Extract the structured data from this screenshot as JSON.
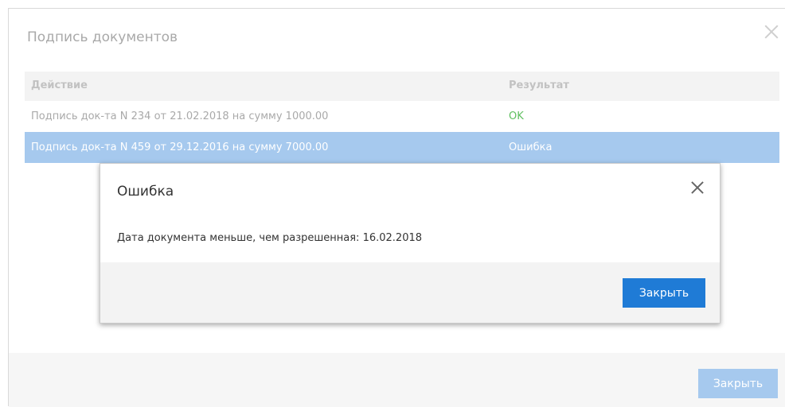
{
  "outer_dialog": {
    "title": "Подпись документов",
    "close_icon": "close-icon",
    "table": {
      "headers": {
        "action": "Действие",
        "result": "Результат"
      },
      "rows": [
        {
          "action": "Подпись док-та N 234 от 21.02.2018 на сумму 1000.00",
          "result": "OK",
          "selected": false
        },
        {
          "action": "Подпись док-та N 459 от 29.12.2016 на сумму 7000.00",
          "result": "Ошибка",
          "selected": true
        }
      ]
    },
    "footer": {
      "close_label": "Закрыть"
    }
  },
  "error_modal": {
    "title": "Ошибка",
    "close_icon": "close-icon",
    "message": "Дата документа меньше, чем разрешенная: 16.02.2018",
    "footer": {
      "close_label": "Закрыть"
    }
  },
  "colors": {
    "selected_row": "#a6c9ee",
    "ok_status": "#5fbf5f",
    "primary_button": "#1f7bd6",
    "disabled_button": "#a6c9ee"
  }
}
